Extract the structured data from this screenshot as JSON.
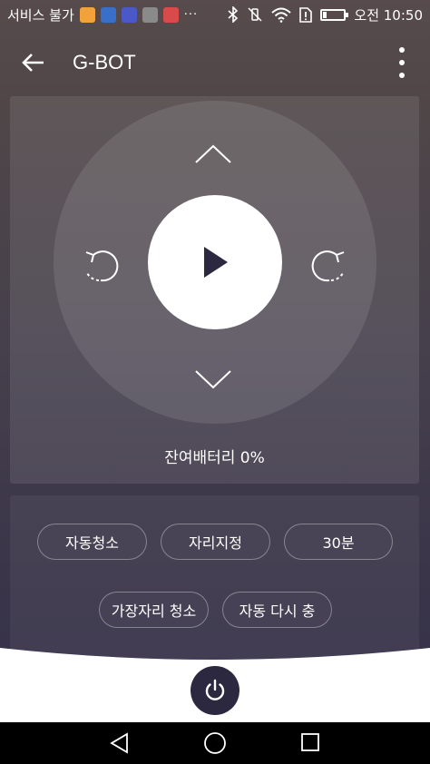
{
  "status_bar": {
    "carrier_text": "서비스 불가",
    "dots": "···",
    "time": "오전 10:50",
    "app_icon_colors": [
      "#f2a23a",
      "#3a6fc9",
      "#4b58c8",
      "#8a8a8a",
      "#d94b4b"
    ]
  },
  "app_bar": {
    "title": "G-BOT"
  },
  "controls": {
    "battery_label": "잔여배터리 0%"
  },
  "modes": {
    "auto_clean": "자동청소",
    "spot": "자리지정",
    "minutes_30": "30분",
    "edge_clean": "가장자리 청소",
    "auto_recharge": "자동 다시 충"
  },
  "colors": {
    "accent_dark": "#2c2840",
    "panel_text": "#ffffff",
    "play_icon": "#2c2840"
  }
}
